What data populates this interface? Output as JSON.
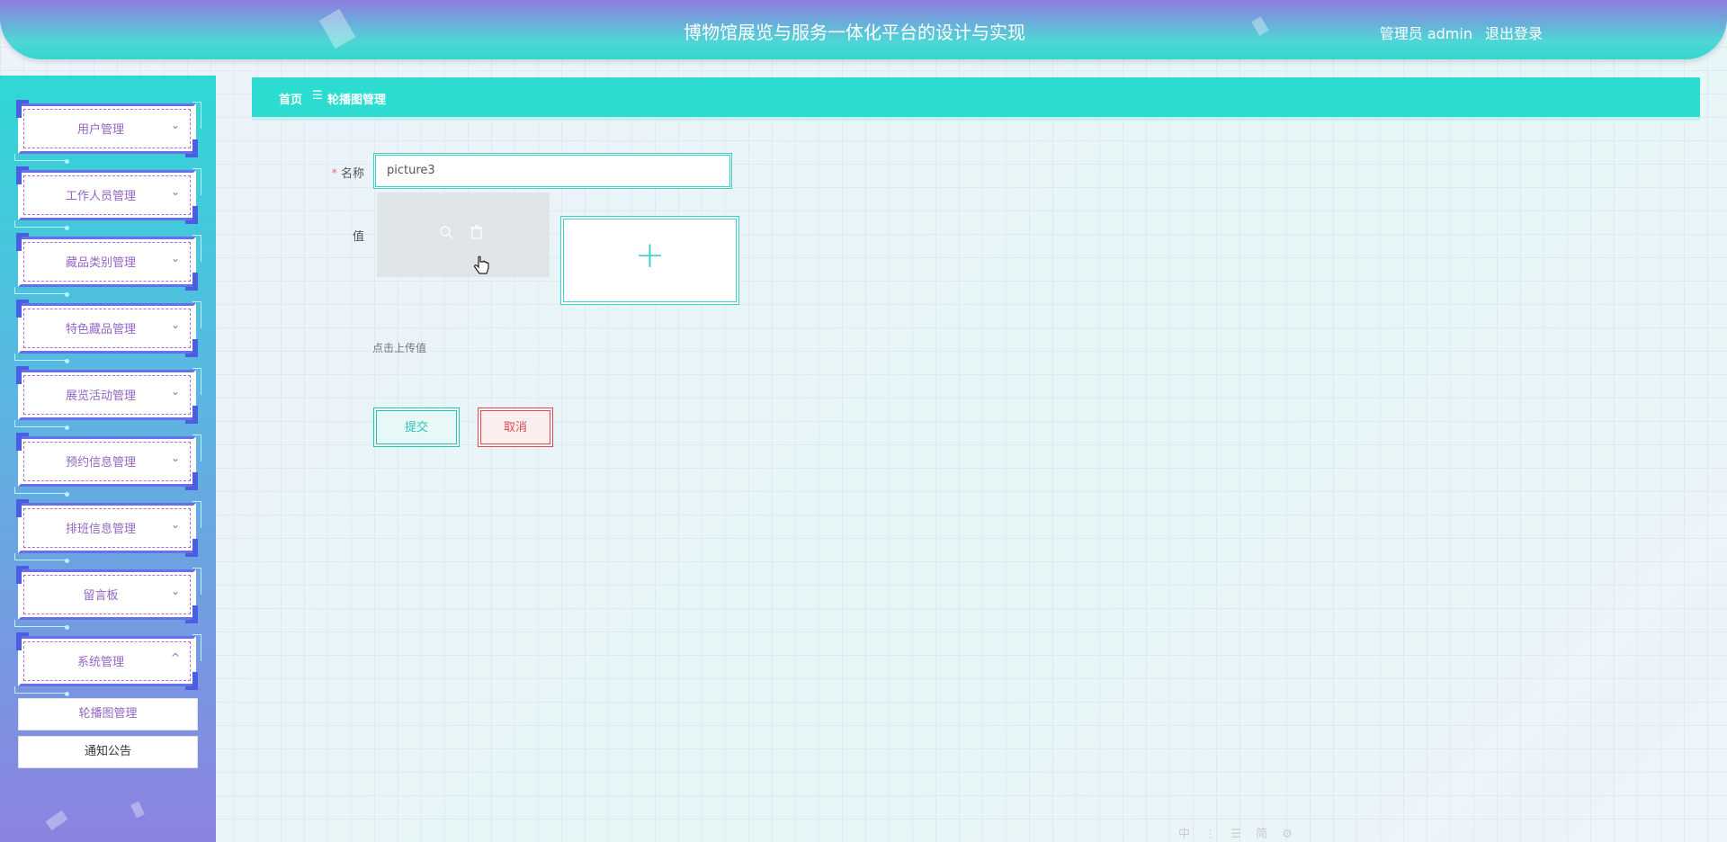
{
  "header": {
    "title": "博物馆展览与服务一体化平台的设计与实现",
    "user_label": "管理员 admin",
    "logout_label": "退出登录"
  },
  "sidebar": {
    "menus": [
      {
        "label": "用户管理",
        "chevron": "⌄"
      },
      {
        "label": "工作人员管理",
        "chevron": "⌄"
      },
      {
        "label": "藏品类别管理",
        "chevron": "⌄"
      },
      {
        "label": "特色藏品管理",
        "chevron": "⌄"
      },
      {
        "label": "展览活动管理",
        "chevron": "⌄"
      },
      {
        "label": "预约信息管理",
        "chevron": "⌄"
      },
      {
        "label": "排班信息管理",
        "chevron": "⌄"
      },
      {
        "label": "留言板",
        "chevron": "⌄"
      },
      {
        "label": "系统管理",
        "chevron": "^"
      }
    ],
    "submenu": [
      {
        "label": "轮播图管理"
      },
      {
        "label": "通知公告"
      }
    ]
  },
  "breadcrumb": {
    "home": "首页",
    "separator": "☰",
    "current": "轮播图管理"
  },
  "form": {
    "name_label": "名称",
    "required_mark": "*",
    "name_value": "picture3",
    "value_label": "值",
    "upload_plus": "+",
    "upload_tip": "点击上传值",
    "submit_label": "提交",
    "cancel_label": "取消"
  },
  "icons": {
    "thumb_actions": [
      "zoom-in-icon",
      "delete-icon"
    ],
    "cursor": "hand-pointer"
  },
  "toolbar": {
    "text": "中 ⋮ ☰ 简 ⚙"
  },
  "colors": {
    "accent": "#2ddcd0",
    "menu_text": "#9465c6",
    "danger": "#d74d55"
  }
}
